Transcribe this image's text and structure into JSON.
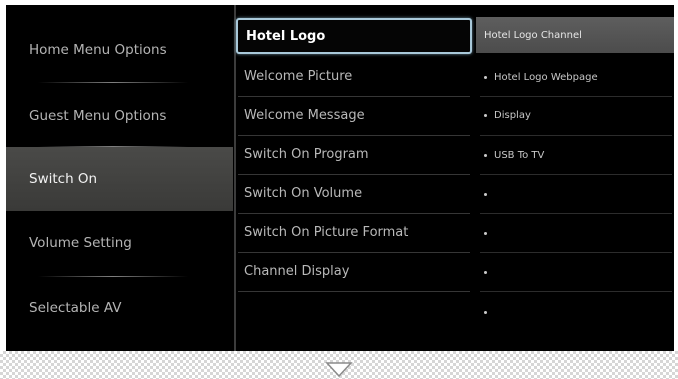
{
  "left_menu": {
    "items": [
      {
        "label": "Home Menu Options",
        "active": false
      },
      {
        "label": "Guest Menu Options",
        "active": false
      },
      {
        "label": "Switch On",
        "active": true
      },
      {
        "label": "Volume Setting",
        "active": false
      },
      {
        "label": "Selectable AV",
        "active": false
      }
    ]
  },
  "middle_menu": {
    "items": [
      {
        "label": "Hotel Logo",
        "selected": true
      },
      {
        "label": "Welcome Picture",
        "selected": false
      },
      {
        "label": "Welcome Message",
        "selected": false
      },
      {
        "label": "Switch On Program",
        "selected": false
      },
      {
        "label": "Switch On Volume",
        "selected": false
      },
      {
        "label": "Switch On Picture Format",
        "selected": false
      },
      {
        "label": "Channel Display",
        "selected": false
      }
    ]
  },
  "options_panel": {
    "highlighted": "Hotel Logo Channel",
    "items": [
      "Hotel Logo Webpage",
      "Display",
      "USB To TV",
      "",
      "",
      "",
      ""
    ]
  },
  "footer": {
    "arrow_icon": "chevron-down-icon"
  },
  "colors": {
    "background": "#000000",
    "active_item": "#434341",
    "selection_border": "#a9c9da",
    "option_highlight": "#585858"
  }
}
